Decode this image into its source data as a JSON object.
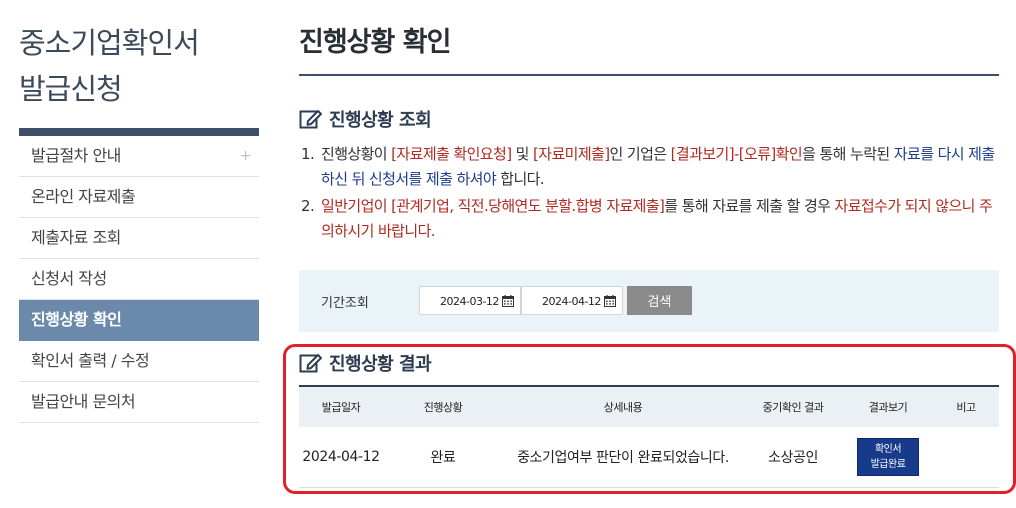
{
  "sidebar": {
    "title_line1": "중소기업확인서",
    "title_line2": "발급신청",
    "items": [
      {
        "label": "발급절차 안내",
        "plus": "+"
      },
      {
        "label": "온라인 자료제출"
      },
      {
        "label": "제출자료 조회"
      },
      {
        "label": "신청서 작성"
      },
      {
        "label": "진행상황 확인"
      },
      {
        "label": "확인서 출력 / 수정"
      },
      {
        "label": "발급안내 문의처"
      }
    ],
    "active_index": 4
  },
  "main": {
    "page_title": "진행상황 확인",
    "inquiry_heading": "진행상황 조회",
    "notice": [
      {
        "num": "1.",
        "parts": [
          {
            "t": "진행상황이 ",
            "c": ""
          },
          {
            "t": "[자료제출 확인요청]",
            "c": "red"
          },
          {
            "t": " 및 ",
            "c": ""
          },
          {
            "t": "[자료미제출]",
            "c": "red"
          },
          {
            "t": "인 기업은 ",
            "c": ""
          },
          {
            "t": "[결과보기]-[오류]확인",
            "c": "red"
          },
          {
            "t": "을 통해 누락된 ",
            "c": ""
          },
          {
            "t": "자료를 다시 제출 하신 뒤 신청서를 제출 하셔야",
            "c": "blue"
          },
          {
            "t": " 합니다.",
            "c": ""
          }
        ]
      },
      {
        "num": "2.",
        "parts": [
          {
            "t": "일반기업이 ",
            "c": "red"
          },
          {
            "t": "[관계기업, 직전.당해연도 분할.합병 자료제출]",
            "c": "red"
          },
          {
            "t": "를 통해 자료를 제출 할 경우 ",
            "c": ""
          },
          {
            "t": "자료접수가 되지 않으니 주의하시기 바랍니다.",
            "c": "red"
          }
        ]
      }
    ],
    "search": {
      "label": "기간조회",
      "start_date": "2024-03-12",
      "end_date": "2024-04-12",
      "button": "검색"
    },
    "result_heading": "진행상황 결과",
    "table": {
      "headers": [
        "발급일자",
        "진행상황",
        "상세내용",
        "중기확인 결과",
        "결과보기",
        "비고"
      ],
      "rows": [
        {
          "date": "2024-04-12",
          "status": "완료",
          "detail": "중소기업여부 판단이 완료되었습니다.",
          "result": "소상공인",
          "view_line1": "확인서",
          "view_line2": "발급완료",
          "note": ""
        }
      ]
    }
  },
  "colors": {
    "accent_navy": "#3e5068",
    "active_menu": "#6b8aab",
    "highlight_outline": "#e0202a",
    "cert_button": "#173a8a"
  }
}
